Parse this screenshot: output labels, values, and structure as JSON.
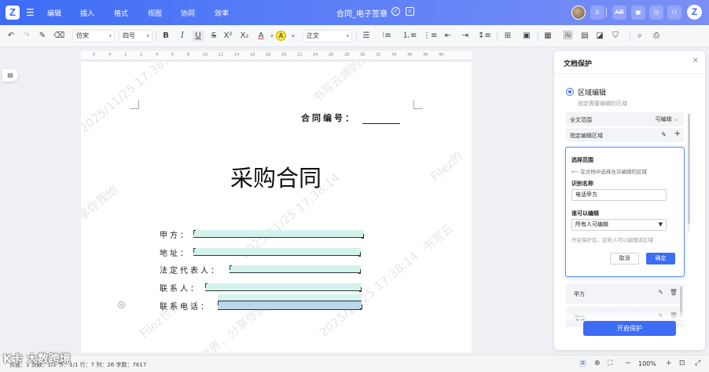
{
  "header": {
    "logo": "Z",
    "menu": [
      "编辑",
      "插入",
      "格式",
      "视图",
      "协同",
      "效率"
    ],
    "doc_title": "合同_电子签章",
    "right_logo": "Z"
  },
  "toolbar": {
    "font_family": "仿宋",
    "font_size": "四号",
    "paragraph_style": "正文",
    "bold": "B",
    "italic": "I",
    "underline": "U",
    "strikethrough": "S",
    "superscript": "X²",
    "subscript": "X₂",
    "font_color": "A",
    "highlight": "A"
  },
  "ruler": {
    "ticks": [
      "6",
      "4",
      "2",
      "2",
      "4",
      "6",
      "8",
      "10",
      "12",
      "14",
      "16",
      "18",
      "20",
      "22",
      "24",
      "26",
      "28",
      "30",
      "32",
      "34",
      "36",
      "38",
      "40"
    ]
  },
  "document": {
    "contract_no_label": "合同编号：",
    "heading": "采购合同",
    "fields": [
      {
        "label": "甲方："
      },
      {
        "label": "地址："
      },
      {
        "label": "法定代表人："
      },
      {
        "label": "联系人："
      },
      {
        "label": "联系电话："
      }
    ],
    "watermarks": [
      "2025/11/25 17:38:14",
      "书写云端的你",
      "Filez的",
      "分享你我他",
      "2025/11/25 17:38:14",
      "书写云",
      "Filez世界",
      "2025/11/25 17:38:14",
      "Filez的世界，分享你我他",
      "书写"
    ]
  },
  "panel": {
    "title": "文档保护",
    "radio_label": "区域编辑",
    "radio_hint": "指定需要编辑的区域",
    "rows": [
      {
        "label": "全文范围",
        "value": "可编辑 ⌵"
      },
      {
        "label": "指定编辑区域",
        "value": ""
      }
    ],
    "popup": {
      "select_range_label": "选择范围",
      "select_range_hint": "⟵ 在文档中选择允许编辑的区域",
      "name_label": "识别名称",
      "name_value": "电话甲方",
      "editor_label": "谁可以编辑",
      "editor_value": "所有人可编辑",
      "editor_hint": "开启保护后，这些人可以编辑该区域",
      "cancel": "取消",
      "ok": "确定"
    },
    "list": [
      {
        "name": "甲方"
      },
      {
        "name": "地址"
      }
    ],
    "start_button": "开启保护"
  },
  "statusbar": {
    "left_text": "页面：1  页数：1/2  节：1/1  行：7  列：26  字数：7617",
    "overlay_brand": "K卡 大数跨境",
    "zoom": "100%"
  }
}
